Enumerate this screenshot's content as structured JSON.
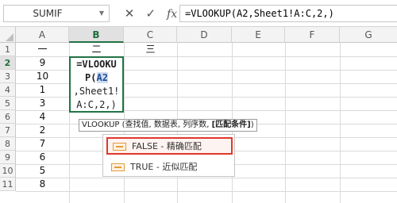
{
  "formula_bar": {
    "name_box": "SUMIF",
    "cancel_icon": "✕",
    "enter_icon": "✓",
    "fx_label": "fx",
    "formula": "=VLOOKUP(A2,Sheet1!A:C,2,)"
  },
  "columns": [
    "A",
    "B",
    "C",
    "D",
    "E",
    "F",
    "G"
  ],
  "active_column": "B",
  "rows": [
    "1",
    "2",
    "3",
    "4",
    "5",
    "6",
    "7",
    "8",
    "9",
    "10",
    "11"
  ],
  "active_row": "2",
  "column_a": [
    "一",
    "9",
    "10",
    "1",
    "3",
    "4",
    "2",
    "7",
    "6",
    "5",
    "8"
  ],
  "column_c": [
    "三"
  ],
  "header_b": "二",
  "edit_cell": {
    "line1": "=VLOOKU",
    "line2_prefix": "P(",
    "line2_ref": "A2",
    "line3": ",Sheet1!",
    "line4": "A:C,2,)"
  },
  "tooltip": {
    "text": "VLOOKUP (查找值, 数据表, 列序数, ",
    "current_arg": "[匹配条件]",
    "close": ")"
  },
  "dropdown": {
    "items": [
      {
        "label": "FALSE - 精确匹配",
        "selected": true
      },
      {
        "label": "TRUE - 近似匹配",
        "selected": false
      }
    ]
  },
  "colors": {
    "accent_green": "#217346",
    "highlight_red": "#e0382b"
  }
}
